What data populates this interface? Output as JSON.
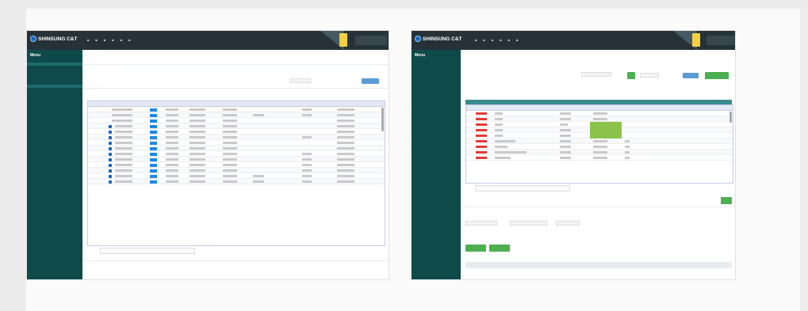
{
  "left_window": {
    "brand": "SHINSUNG C&T",
    "nav": [
      "",
      "",
      "",
      "",
      "",
      ""
    ],
    "sidebar": {
      "title": "Menu",
      "items": [
        "",
        "",
        "",
        "",
        "",
        ""
      ]
    },
    "page_title": "",
    "breadcrumb": ""
  },
  "right_window": {
    "brand": "SHINSUNG C&T",
    "nav": [
      "",
      "",
      "",
      "",
      "",
      ""
    ],
    "sidebar": {
      "title": "Menu",
      "items": [
        "",
        "",
        "",
        ""
      ]
    },
    "page_title": "",
    "breadcrumb": ""
  },
  "colors": {
    "topbar": "#263238",
    "sidebar": "#0e4a4a",
    "accent_yellow": "#f4d03f",
    "button_blue": "#5b9bd5",
    "button_green": "#4caf50",
    "row_highlight_green": "#8bc34a",
    "status_red": "#e53935"
  }
}
